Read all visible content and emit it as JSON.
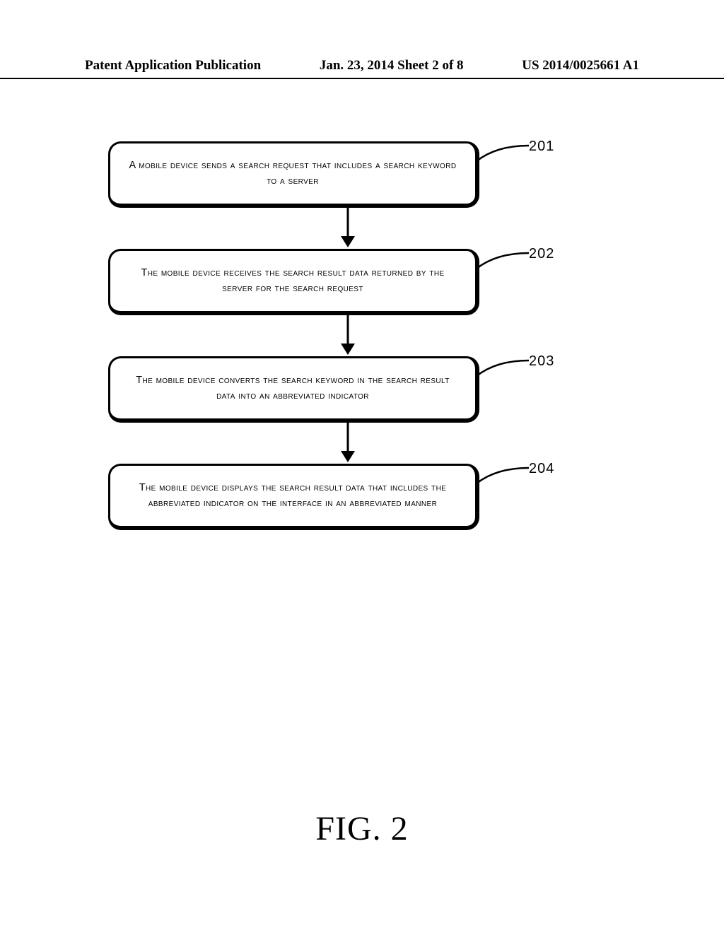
{
  "header": {
    "left": "Patent Application Publication",
    "middle": "Jan. 23, 2014  Sheet 2 of 8",
    "right": "US 2014/0025661 A1"
  },
  "steps": [
    {
      "ref": "201",
      "text": "A mobile device sends a search request that includes a search keyword to a server"
    },
    {
      "ref": "202",
      "text": "The mobile device receives the search result data returned by the server for the search request"
    },
    {
      "ref": "203",
      "text": "The mobile device converts the search keyword in the search result data into an abbreviated indicator"
    },
    {
      "ref": "204",
      "text": "The mobile device displays the search result data that includes the abbreviated indicator on the interface in an abbreviated manner"
    }
  ],
  "figure_label": "FIG. 2"
}
